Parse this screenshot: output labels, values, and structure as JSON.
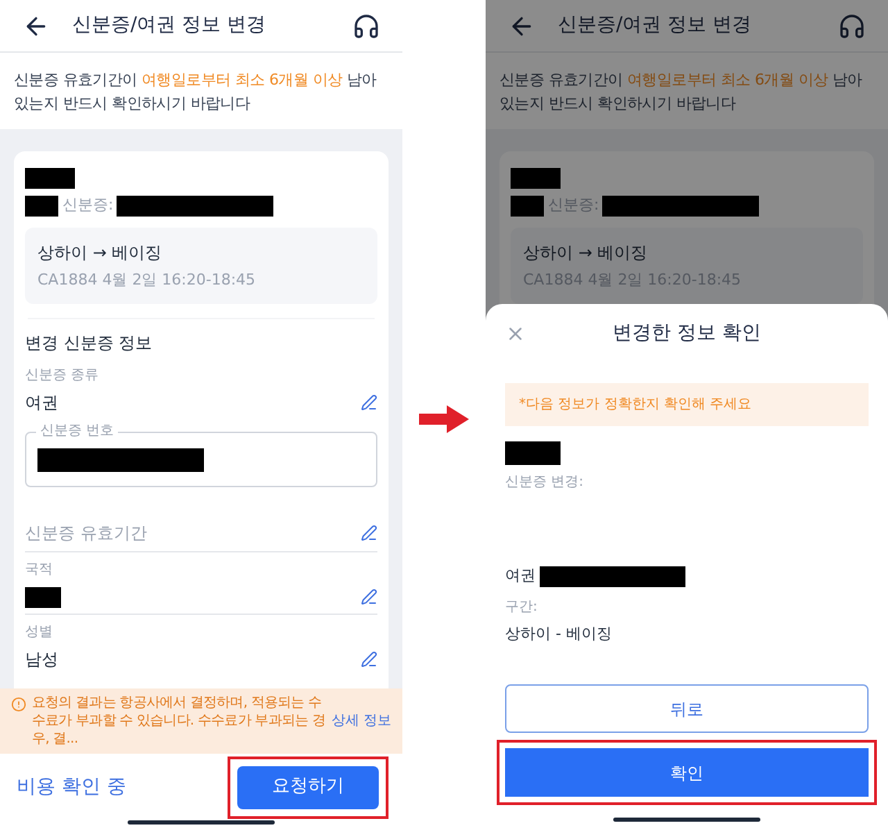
{
  "left_screen": {
    "header": {
      "title": "신분증/여권 정보 변경"
    },
    "notice": [
      {
        "text": "신분증 유효기간이 ",
        "highlight": false
      },
      {
        "text": "여행일로부터 최소 6개월 이상",
        "highlight": true
      },
      {
        "text": " 남아있는지 반드시 확인하시기 바랍니다",
        "highlight": false
      }
    ],
    "passenger": {
      "name_redacted": true,
      "id_prefix_redacted": true,
      "id_label": "신분증:",
      "id_redacted": true
    },
    "route": {
      "title": "상하이 → 베이징",
      "detail": "CA1884 4월 2일 16:20-18:45"
    },
    "section_title": "변경 신분증 정보",
    "fields": [
      {
        "kind": "plain",
        "label": "신분증 종류",
        "value": "여권",
        "editable": true
      },
      {
        "kind": "outlined",
        "label": "신분증 번호",
        "redacted": true
      },
      {
        "kind": "placeholder",
        "placeholder": "신분증 유효기간",
        "editable": true
      },
      {
        "kind": "plain",
        "label": "국적",
        "redacted": true,
        "editable": true
      },
      {
        "kind": "plain",
        "label": "성별",
        "value": "남성",
        "editable": true
      }
    ],
    "warning": {
      "text": "요청의 결과는 항공사에서 결정하며, 적용되는 수수료가 부과할 수 있습니다. 수수료가 부과되는 경우, 결...",
      "link": "상세 정보"
    },
    "footer": {
      "status": "비용 확인 중",
      "button": "요청하기",
      "highlighted": true
    }
  },
  "right_screen": {
    "header": {
      "title": "신분증/여권 정보 변경"
    },
    "notice": [
      {
        "text": "신분증 유효기간이 ",
        "highlight": false
      },
      {
        "text": "여행일로부터 최소 6개월 이상",
        "highlight": true
      },
      {
        "text": " 남아있는지 반드시 확인하시기 바랍니다",
        "highlight": false
      }
    ],
    "passenger": {
      "name_redacted": true,
      "id_prefix_redacted": true,
      "id_label": "신분증:",
      "id_redacted": true
    },
    "route": {
      "title": "상하이 → 베이징",
      "detail": "CA1884 4월 2일 16:20-18:45"
    },
    "dialog": {
      "title": "변경한 정보 확인",
      "hint": "*다음 정보가 정확한지 확인해 주세요",
      "name_redacted": true,
      "change_label": "신분증 변경:",
      "id_type": "여권",
      "id_redacted": true,
      "segment_label": "구간:",
      "segment": "상하이 - 베이징",
      "buttons": [
        {
          "kind": "outline",
          "label": "뒤로",
          "highlighted": false
        },
        {
          "kind": "primary",
          "label": "확인",
          "highlighted": true
        }
      ]
    }
  }
}
